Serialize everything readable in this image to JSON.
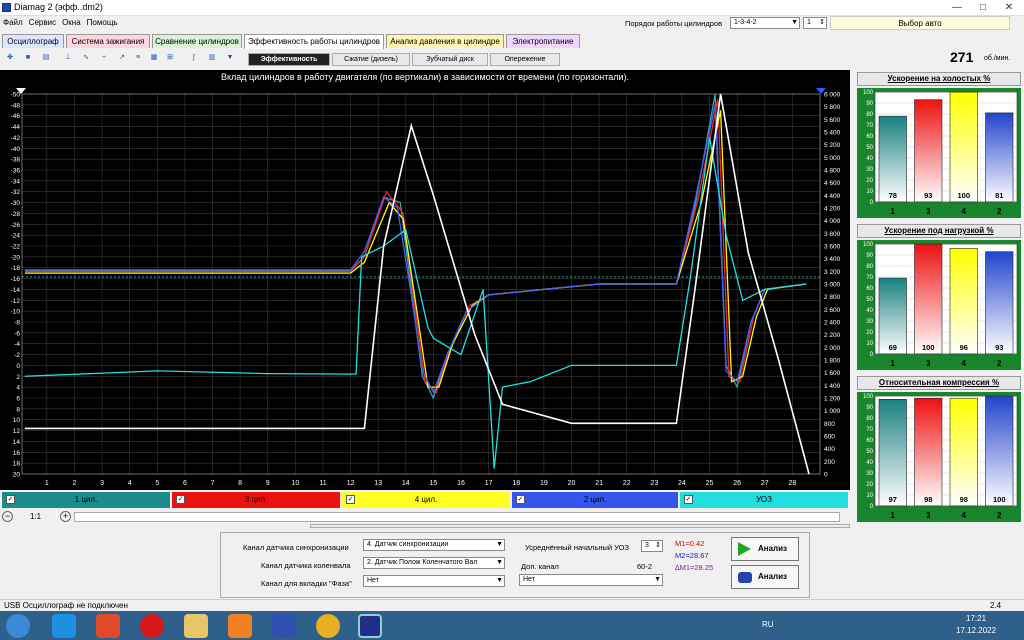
{
  "window": {
    "title": "Diamag 2 (эфф..dm2)"
  },
  "menu": [
    "Файл",
    "Сервис",
    "Окна",
    "Помощь"
  ],
  "cyl_order": {
    "label": "Порядок работы цилиндров",
    "value": "1-3-4-2",
    "spin": "1"
  },
  "select_car": "Выбор авто",
  "tabs": [
    {
      "label": "Осциллограф",
      "color": "#dbe7ff"
    },
    {
      "label": "Система зажигания",
      "color": "#ffd6e0"
    },
    {
      "label": "Сравнение цилиндров",
      "color": "#d6f5d6"
    },
    {
      "label": "Эффективность работы цилиндров",
      "color": "#ffffff"
    },
    {
      "label": "Анализ давления в цилиндре",
      "color": "#fff5b0"
    },
    {
      "label": "Электропитание",
      "color": "#f0d6ff"
    }
  ],
  "subtabs": [
    "Эффективность",
    "Сжатие (дизель)",
    "Зубчатый диск",
    "Опережение"
  ],
  "rpm": {
    "value": "271",
    "unit": "об./мин."
  },
  "chart_data": {
    "type": "line",
    "title": "Вклад цилиндров в работу двигателя (по вертикали) в зависимости от времени (по горизонтали).",
    "x_ticks": [
      "1",
      "2",
      "3",
      "4",
      "5",
      "6",
      "7",
      "8",
      "9",
      "10",
      "11",
      "12",
      "13",
      "14",
      "15",
      "16",
      "17",
      "18",
      "19",
      "20",
      "21",
      "22",
      "23",
      "24",
      "25",
      "26",
      "27",
      "28"
    ],
    "y_left_ticks": [
      "-50",
      "-48",
      "-46",
      "-44",
      "-42",
      "-40",
      "-38",
      "-36",
      "-34",
      "-32",
      "-30",
      "-28",
      "-26",
      "-24",
      "-22",
      "-20",
      "-18",
      "-16",
      "-14",
      "-12",
      "-10",
      "-8",
      "-6",
      "-4",
      "-2",
      "0",
      "2",
      "4",
      "6",
      "8",
      "10",
      "12",
      "14",
      "16",
      "18",
      "20"
    ],
    "y_right_ticks": [
      "6 000",
      "5 800",
      "5 600",
      "5 400",
      "5 200",
      "5 000",
      "4 800",
      "4 600",
      "4 400",
      "4 200",
      "4 000",
      "3 800",
      "3 600",
      "3 400",
      "3 200",
      "3 000",
      "2 800",
      "2 600",
      "2 400",
      "2 200",
      "2 000",
      "1 800",
      "1 600",
      "1 400",
      "1 200",
      "1 000",
      "800",
      "600",
      "400",
      "200",
      "0"
    ],
    "xlim": [
      0.1,
      29
    ],
    "ylim_left": [
      -50,
      20
    ],
    "ylim_right": [
      0,
      6000
    ],
    "series": [
      {
        "name": "1 цил.",
        "color": "#2fa8a8",
        "values": [
          [
            0.2,
            -17.5
          ],
          [
            12,
            -17.5
          ],
          [
            12.5,
            -20
          ],
          [
            13.2,
            -31
          ],
          [
            13.8,
            -30
          ],
          [
            14.2,
            -14
          ],
          [
            14.6,
            2
          ],
          [
            15,
            6
          ],
          [
            15.5,
            -2
          ],
          [
            16.2,
            -10
          ],
          [
            17,
            -13
          ],
          [
            19,
            -14
          ],
          [
            21,
            -15
          ],
          [
            23.8,
            -15
          ],
          [
            24.5,
            -30
          ],
          [
            25.2,
            -50
          ],
          [
            25.6,
            0
          ],
          [
            26,
            4
          ],
          [
            26.5,
            -8
          ],
          [
            27,
            -14
          ],
          [
            28.5,
            -15
          ]
        ]
      },
      {
        "name": "3 цил.",
        "color": "#ff2020",
        "values": [
          [
            0.2,
            -17.3
          ],
          [
            12,
            -17.3
          ],
          [
            12.5,
            -20
          ],
          [
            13.3,
            -32
          ],
          [
            13.9,
            -28
          ],
          [
            14.3,
            -12
          ],
          [
            14.7,
            3
          ],
          [
            15.1,
            5
          ],
          [
            15.6,
            -3
          ],
          [
            16.3,
            -11
          ],
          [
            17,
            -13
          ],
          [
            19,
            -14
          ],
          [
            21,
            -15
          ],
          [
            23.8,
            -15
          ],
          [
            24.6,
            -31
          ],
          [
            25.3,
            -49
          ],
          [
            25.7,
            2
          ],
          [
            26.1,
            3
          ],
          [
            26.6,
            -9
          ],
          [
            27,
            -14
          ],
          [
            28.5,
            -15
          ]
        ]
      },
      {
        "name": "4 цил.",
        "color": "#ffff00",
        "values": [
          [
            0.2,
            -17
          ],
          [
            12,
            -17
          ],
          [
            12.5,
            -19
          ],
          [
            13.4,
            -30
          ],
          [
            13.9,
            -27
          ],
          [
            14.4,
            -10
          ],
          [
            14.8,
            4
          ],
          [
            15.2,
            4
          ],
          [
            15.7,
            -4
          ],
          [
            16.4,
            -11
          ],
          [
            17,
            -13
          ],
          [
            19,
            -14
          ],
          [
            21,
            -15
          ],
          [
            23.8,
            -15
          ],
          [
            24.7,
            -30
          ],
          [
            25.4,
            -47
          ],
          [
            25.8,
            3
          ],
          [
            26.2,
            2
          ],
          [
            26.7,
            -9
          ],
          [
            27.1,
            -14
          ],
          [
            28.5,
            -15
          ]
        ]
      },
      {
        "name": "2 цил.",
        "color": "#4060ff",
        "values": [
          [
            0.2,
            -17.6
          ],
          [
            12,
            -17.6
          ],
          [
            12.5,
            -21
          ],
          [
            13.2,
            -31
          ],
          [
            13.7,
            -29
          ],
          [
            14.2,
            -13
          ],
          [
            14.6,
            1
          ],
          [
            15,
            5
          ],
          [
            15.5,
            -2
          ],
          [
            16.2,
            -10
          ],
          [
            17,
            -13
          ],
          [
            19,
            -14
          ],
          [
            21,
            -15
          ],
          [
            23.8,
            -15
          ],
          [
            24.5,
            -31
          ],
          [
            25.2,
            -48
          ],
          [
            25.6,
            1
          ],
          [
            26,
            3
          ],
          [
            26.5,
            -8
          ],
          [
            27,
            -14
          ],
          [
            28.5,
            -15
          ]
        ]
      },
      {
        "name": "УОЗ",
        "color": "#20e0e0",
        "values": [
          [
            0.2,
            2
          ],
          [
            5,
            1
          ],
          [
            9,
            1.5
          ],
          [
            12.2,
            1.6
          ],
          [
            12.4,
            -20
          ],
          [
            13.2,
            -22
          ],
          [
            14,
            -25
          ],
          [
            14.8,
            -7
          ],
          [
            15,
            -5
          ],
          [
            16,
            -2
          ],
          [
            16.8,
            -14
          ],
          [
            17.2,
            19
          ],
          [
            17.5,
            4
          ],
          [
            18.5,
            3
          ],
          [
            20,
            0
          ],
          [
            23.8,
            0
          ],
          [
            24.3,
            -16
          ],
          [
            25,
            -42
          ],
          [
            25.6,
            -24
          ],
          [
            26.2,
            -12
          ],
          [
            27,
            -14
          ],
          [
            28.5,
            -15
          ]
        ]
      }
    ],
    "rpm_series": {
      "color": "#ffffff",
      "values": [
        [
          0.2,
          720
        ],
        [
          12.5,
          720
        ],
        [
          13.2,
          3600
        ],
        [
          14.2,
          5500
        ],
        [
          15,
          4400
        ],
        [
          16.5,
          2200
        ],
        [
          17.5,
          1100
        ],
        [
          20,
          800
        ],
        [
          23.8,
          800
        ],
        [
          24.5,
          3000
        ],
        [
          25.4,
          6000
        ],
        [
          26.4,
          3500
        ],
        [
          27.5,
          1800
        ],
        [
          28.6,
          0
        ]
      ]
    },
    "ref_line_left": -16.3
  },
  "legend": [
    "1 цил.",
    "3 цил.",
    "4 цил.",
    "2 цил.",
    "УОЗ"
  ],
  "legend_colors": [
    "#1a8c8c",
    "#ee1111",
    "#ffff22",
    "#3355ee",
    "#22dddd"
  ],
  "zoom": "1:1",
  "bar_charts": [
    {
      "title": "Ускорение на холостых %",
      "cyls": [
        "1",
        "3",
        "4",
        "2"
      ],
      "values": [
        78,
        93,
        100,
        81
      ]
    },
    {
      "title": "Ускорение под нагрузкой %",
      "cyls": [
        "1",
        "3",
        "4",
        "2"
      ],
      "values": [
        69,
        100,
        96,
        93
      ]
    },
    {
      "title": "Относительная компрессия %",
      "cyls": [
        "1",
        "3",
        "4",
        "2"
      ],
      "values": [
        97,
        98,
        98,
        100
      ]
    }
  ],
  "bar_axis": [
    "100",
    "90",
    "80",
    "70",
    "60",
    "50",
    "40",
    "30",
    "20",
    "10",
    "0"
  ],
  "bar_colors": [
    "#1a8080",
    "#ee1111",
    "#ffff00",
    "#2244cc"
  ],
  "controls": {
    "sync_label": "Канал датчика синхронизации",
    "sync_value": "4. Датчик синхронизации",
    "crank_label": "Канал датчика коленвала",
    "crank_value": "2. Датчик Полож Коленчатого Вал",
    "phase_label": "Канал для вкладки \"Фаза\"",
    "phase_value": "Нет",
    "uoz_label": "Усреднённый начальный УОЗ",
    "uoz_value": "3",
    "aux_label": "Доп. канал",
    "aux_extra": "60-2",
    "aux_value": "Нет",
    "m1": "M1=0.42",
    "m2": "M2=28.67",
    "dm": "∆M1=28.25",
    "analyze1": "Анализ",
    "analyze2": "Анализ"
  },
  "status": {
    "left": "USB Осциллограф не подключен",
    "right": "2.4"
  },
  "taskbar": {
    "lang": "RU",
    "time": "17:21",
    "date": "17.12.2022"
  }
}
